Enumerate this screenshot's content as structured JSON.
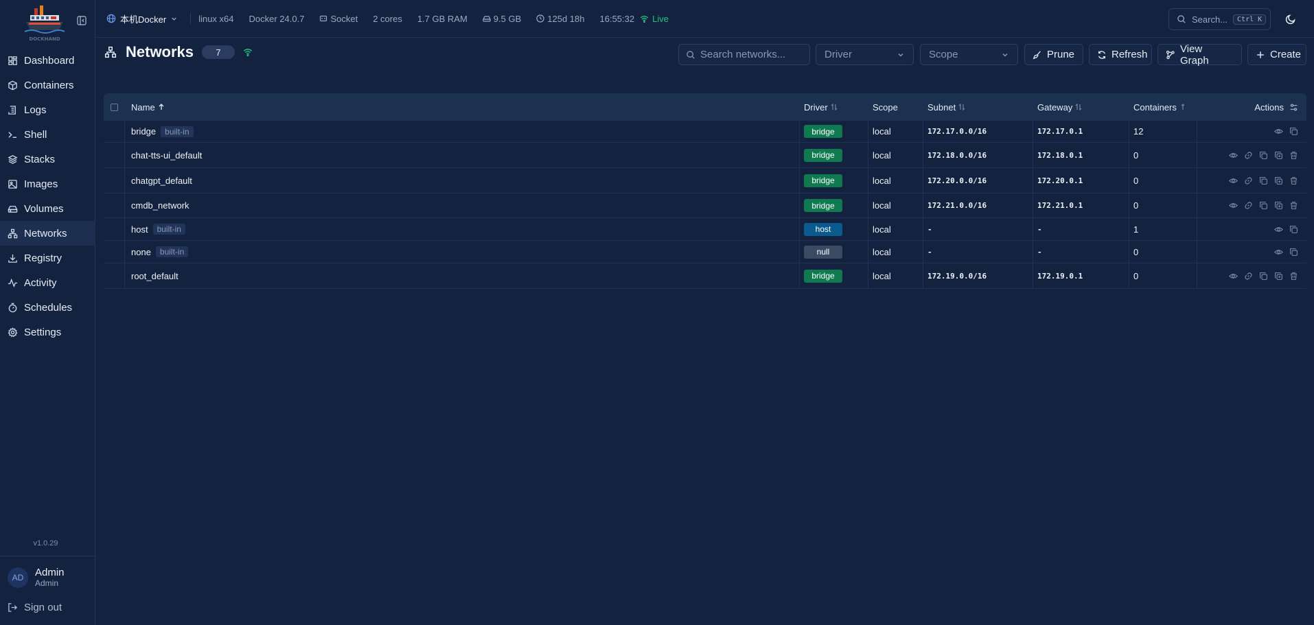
{
  "app": {
    "logo_text": "DOCKHAND",
    "version": "v1.0.29"
  },
  "nav": {
    "items": [
      {
        "label": "Dashboard",
        "icon": "dashboard-icon"
      },
      {
        "label": "Containers",
        "icon": "box-icon"
      },
      {
        "label": "Logs",
        "icon": "logs-icon"
      },
      {
        "label": "Shell",
        "icon": "terminal-icon"
      },
      {
        "label": "Stacks",
        "icon": "layers-icon"
      },
      {
        "label": "Images",
        "icon": "image-icon"
      },
      {
        "label": "Volumes",
        "icon": "drive-icon"
      },
      {
        "label": "Networks",
        "icon": "network-icon",
        "active": true
      },
      {
        "label": "Registry",
        "icon": "download-icon"
      },
      {
        "label": "Activity",
        "icon": "activity-icon"
      },
      {
        "label": "Schedules",
        "icon": "timer-icon"
      },
      {
        "label": "Settings",
        "icon": "gear-icon"
      }
    ]
  },
  "user": {
    "initials": "AD",
    "name": "Admin",
    "role": "Admin",
    "signout": "Sign out"
  },
  "topbar": {
    "environment": "本机Docker",
    "os": "linux x64",
    "docker": "Docker 24.0.7",
    "socket": "Socket",
    "cores": "2 cores",
    "ram": "1.7 GB RAM",
    "disk": "9.5 GB",
    "uptime": "125d 18h",
    "time": "16:55:32",
    "live": "Live",
    "search_label": "Search...",
    "search_shortcut": "Ctrl K"
  },
  "page": {
    "title": "Networks",
    "count": "7",
    "search_placeholder": "Search networks...",
    "driver_filter": "Driver",
    "scope_filter": "Scope",
    "prune": "Prune",
    "refresh": "Refresh",
    "view_graph": "View Graph",
    "create": "Create"
  },
  "table": {
    "headers": {
      "name": "Name",
      "driver": "Driver",
      "scope": "Scope",
      "subnet": "Subnet",
      "gateway": "Gateway",
      "containers": "Containers",
      "actions": "Actions"
    },
    "rows": [
      {
        "name": "bridge",
        "builtin": "built-in",
        "driver": "bridge",
        "scope": "local",
        "subnet": "172.17.0.0/16",
        "gateway": "172.17.0.1",
        "containers": "12"
      },
      {
        "name": "chat-tts-ui_default",
        "builtin": "",
        "driver": "bridge",
        "scope": "local",
        "subnet": "172.18.0.0/16",
        "gateway": "172.18.0.1",
        "containers": "0"
      },
      {
        "name": "chatgpt_default",
        "builtin": "",
        "driver": "bridge",
        "scope": "local",
        "subnet": "172.20.0.0/16",
        "gateway": "172.20.0.1",
        "containers": "0"
      },
      {
        "name": "cmdb_network",
        "builtin": "",
        "driver": "bridge",
        "scope": "local",
        "subnet": "172.21.0.0/16",
        "gateway": "172.21.0.1",
        "containers": "0"
      },
      {
        "name": "host",
        "builtin": "built-in",
        "driver": "host",
        "scope": "local",
        "subnet": "-",
        "gateway": "-",
        "containers": "1"
      },
      {
        "name": "none",
        "builtin": "built-in",
        "driver": "null",
        "scope": "local",
        "subnet": "-",
        "gateway": "-",
        "containers": "0"
      },
      {
        "name": "root_default",
        "builtin": "",
        "driver": "bridge",
        "scope": "local",
        "subnet": "172.19.0.0/16",
        "gateway": "172.19.0.1",
        "containers": "0"
      }
    ]
  },
  "colors": {
    "bridge": "#0f7a4f",
    "host": "#0b5a8e",
    "null": "#3a4a63",
    "live": "#26c281"
  }
}
